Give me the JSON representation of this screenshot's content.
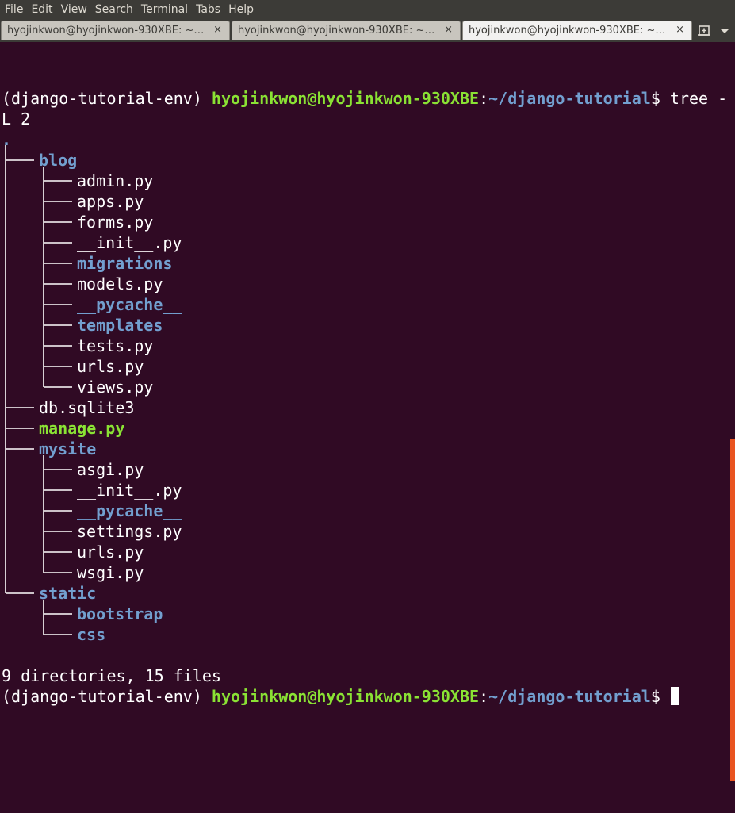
{
  "menu": [
    "File",
    "Edit",
    "View",
    "Search",
    "Terminal",
    "Tabs",
    "Help"
  ],
  "tabs": [
    {
      "label": "hyojinkwon@hyojinkwon-930XBE: ~…",
      "active": false
    },
    {
      "label": "hyojinkwon@hyojinkwon-930XBE: ~…",
      "active": false
    },
    {
      "label": "hyojinkwon@hyojinkwon-930XBE: ~…",
      "active": true
    }
  ],
  "tab_close_glyph": "×",
  "icons": {
    "new_tab": "new-tab-icon",
    "tab_menu": "chevron-down-icon"
  },
  "colors": {
    "background": "#300a24",
    "prompt_user": "#8ae234",
    "path_dir": "#729fcf",
    "scrollbar": "#e95420"
  },
  "prompt": {
    "env": "(django-tutorial-env) ",
    "userhost": "hyojinkwon@hyojinkwon-930XBE",
    "sep": ":",
    "path": "~/django-tutorial",
    "dollar": "$ "
  },
  "command": {
    "first": "tree -",
    "wrap": "L 2"
  },
  "tree": {
    "root": ".",
    "items": [
      {
        "name": "blog",
        "kind": "dir"
      },
      {
        "name": "admin.py",
        "kind": "file"
      },
      {
        "name": "apps.py",
        "kind": "file"
      },
      {
        "name": "forms.py",
        "kind": "file"
      },
      {
        "name": "__init__.py",
        "kind": "file"
      },
      {
        "name": "migrations",
        "kind": "dir"
      },
      {
        "name": "models.py",
        "kind": "file"
      },
      {
        "name": "__pycache__",
        "kind": "dir"
      },
      {
        "name": "templates",
        "kind": "dir"
      },
      {
        "name": "tests.py",
        "kind": "file"
      },
      {
        "name": "urls.py",
        "kind": "file"
      },
      {
        "name": "views.py",
        "kind": "file"
      },
      {
        "name": "db.sqlite3",
        "kind": "file"
      },
      {
        "name": "manage.py",
        "kind": "exec"
      },
      {
        "name": "mysite",
        "kind": "dir"
      },
      {
        "name": "asgi.py",
        "kind": "file"
      },
      {
        "name": "__init__.py",
        "kind": "file"
      },
      {
        "name": "__pycache__",
        "kind": "dir"
      },
      {
        "name": "settings.py",
        "kind": "file"
      },
      {
        "name": "urls.py",
        "kind": "file"
      },
      {
        "name": "wsgi.py",
        "kind": "file"
      },
      {
        "name": "static",
        "kind": "dir"
      },
      {
        "name": "bootstrap",
        "kind": "dir"
      },
      {
        "name": "css",
        "kind": "dir"
      }
    ]
  },
  "summary": "9 directories, 15 files"
}
